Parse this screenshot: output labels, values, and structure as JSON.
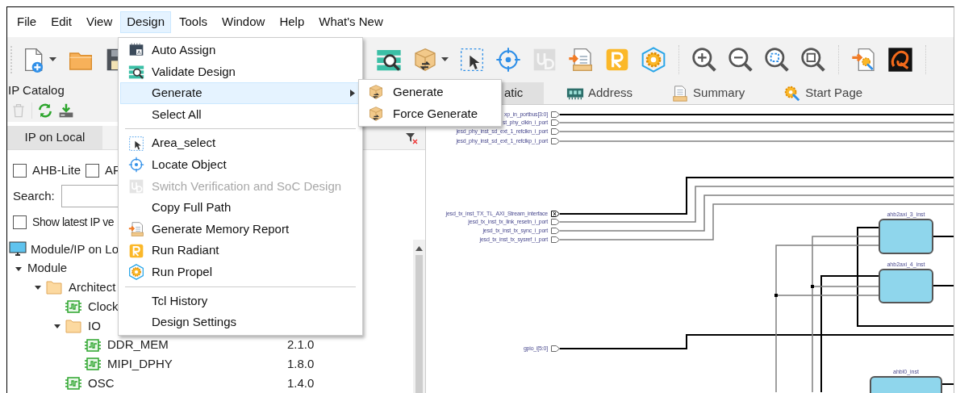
{
  "menu_bar": [
    {
      "label": "File",
      "selected": false
    },
    {
      "label": "Edit",
      "selected": false
    },
    {
      "label": "View",
      "selected": false
    },
    {
      "label": "Design",
      "selected": true
    },
    {
      "label": "Tools",
      "selected": false
    },
    {
      "label": "Window",
      "selected": false
    },
    {
      "label": "Help",
      "selected": false
    },
    {
      "label": "What's New",
      "selected": false
    }
  ],
  "toolbar": {
    "left": [
      {
        "kind": "new",
        "dropdown": true,
        "disabled": false
      },
      {
        "kind": "open",
        "dropdown": false,
        "disabled": false
      },
      {
        "kind": "save",
        "dropdown": false,
        "disabled": false
      }
    ],
    "right": [
      {
        "kind": "validate",
        "dropdown": false,
        "disabled": false
      },
      {
        "kind": "generate",
        "dropdown": true,
        "disabled": false
      },
      {
        "kind": "area_select",
        "dropdown": false,
        "disabled": false
      },
      {
        "kind": "locate",
        "dropdown": false,
        "disabled": false
      },
      {
        "kind": "switch",
        "dropdown": false,
        "disabled": true
      },
      {
        "kind": "memory_report",
        "dropdown": false,
        "disabled": false
      },
      {
        "kind": "radiant",
        "dropdown": false,
        "disabled": false
      },
      {
        "kind": "propel",
        "dropdown": false,
        "disabled": false
      },
      {
        "kind": "separator"
      },
      {
        "kind": "zoom_in",
        "dropdown": false,
        "disabled": false
      },
      {
        "kind": "zoom_out",
        "dropdown": false,
        "disabled": false
      },
      {
        "kind": "zoom_fit",
        "dropdown": false,
        "disabled": false
      },
      {
        "kind": "zoom_area",
        "dropdown": false,
        "disabled": false
      },
      {
        "kind": "separator"
      },
      {
        "kind": "generate_doc",
        "dropdown": false,
        "disabled": false
      },
      {
        "kind": "q_logo",
        "dropdown": false,
        "disabled": false
      },
      {
        "kind": "separator"
      }
    ]
  },
  "design_menu": {
    "items": [
      {
        "kind": "auto_assign",
        "label": "Auto Assign",
        "selected": false,
        "disabled": false,
        "submenu": false
      },
      {
        "kind": "validate",
        "label": "Validate Design",
        "selected": false,
        "disabled": false,
        "submenu": false
      },
      {
        "kind": "plain",
        "label": "Generate",
        "selected": true,
        "disabled": false,
        "submenu": true
      },
      {
        "kind": "plain",
        "label": "Select All",
        "selected": false,
        "disabled": false,
        "submenu": false
      },
      {
        "kind": "separator"
      },
      {
        "kind": "area_select",
        "label": "Area_select",
        "selected": false,
        "disabled": false,
        "submenu": false
      },
      {
        "kind": "locate",
        "label": "Locate Object",
        "selected": false,
        "disabled": false,
        "submenu": false
      },
      {
        "kind": "switch",
        "label": "Switch Verification and SoC Design",
        "selected": false,
        "disabled": true,
        "submenu": false
      },
      {
        "kind": "plain",
        "label": "Copy Full Path",
        "selected": false,
        "disabled": false,
        "submenu": false
      },
      {
        "kind": "memory_report",
        "label": "Generate Memory Report",
        "selected": false,
        "disabled": false,
        "submenu": false
      },
      {
        "kind": "radiant",
        "label": "Run Radiant",
        "selected": false,
        "disabled": false,
        "submenu": false
      },
      {
        "kind": "propel",
        "label": "Run Propel",
        "selected": false,
        "disabled": false,
        "submenu": false
      },
      {
        "kind": "separator"
      },
      {
        "kind": "plain",
        "label": "Tcl History",
        "selected": false,
        "disabled": false,
        "submenu": false
      },
      {
        "kind": "plain",
        "label": "Design Settings",
        "selected": false,
        "disabled": false,
        "submenu": false
      }
    ]
  },
  "generate_submenu": {
    "items": [
      {
        "kind": "generate",
        "label": "Generate",
        "selected": false
      },
      {
        "kind": "generate",
        "label": "Force Generate",
        "selected": false
      }
    ]
  },
  "ip_catalog": {
    "title": "IP Catalog",
    "toolbar": [
      {
        "kind": "delete",
        "disabled": true
      },
      {
        "kind": "refresh",
        "disabled": false
      },
      {
        "kind": "install",
        "disabled": false
      }
    ],
    "tabs": [
      {
        "label": "IP on Local",
        "selected": true
      }
    ],
    "filters": [
      {
        "label": "AHB-Lite",
        "checked": false
      },
      {
        "label": "AP",
        "checked": false
      }
    ],
    "search": {
      "label": "Search:"
    },
    "show_latest": {
      "label": "Show latest IP ve",
      "checked": false
    },
    "tree": {
      "header": "Module/IP on Lo",
      "items": [
        {
          "label": "Module",
          "kind": "group",
          "expanded": true,
          "children": [
            {
              "label": "Architect",
              "kind": "folder",
              "expanded": true,
              "children": [
                {
                  "label": "Clock",
                  "kind": "ip"
                },
                {
                  "label": "IO",
                  "kind": "folder",
                  "expanded": true,
                  "children": [
                    {
                      "label": "DDR_MEM",
                      "kind": "ip",
                      "version": "2.1.0"
                    },
                    {
                      "label": "MIPI_DPHY",
                      "kind": "ip",
                      "version": "1.8.0"
                    }
                  ]
                },
                {
                  "label": "OSC",
                  "kind": "ip",
                  "version": "1.4.0"
                }
              ]
            }
          ]
        }
      ]
    }
  },
  "editor_tabs": [
    {
      "kind": "schematic",
      "label": "atic",
      "selected": true
    },
    {
      "kind": "address",
      "label": "Address",
      "selected": false
    },
    {
      "kind": "summary",
      "label": "Summary",
      "selected": false
    },
    {
      "kind": "start",
      "label": "Start Page",
      "selected": false
    }
  ],
  "schematic": {
    "ports": [
      {
        "label": "xp_in_portbus[3:0]",
        "kind": "bus"
      },
      {
        "label": "st_phy_clkin_i_port",
        "kind": "wire"
      },
      {
        "label": "jesd_phy_inst_sd_ext_1_refclkn_i_port",
        "kind": "wire"
      },
      {
        "label": "jesd_phy_inst_sd_ext_1_refclkp_i_port",
        "kind": "wire"
      },
      {
        "label": "jesd_tx_inst_TX_TL_AXI_Stream_interface",
        "kind": "interface"
      },
      {
        "label": "jesd_tx_inst_tx_link_resetn_i_port",
        "kind": "wire"
      },
      {
        "label": "jesd_tx_inst_tx_sync_i_port",
        "kind": "wire"
      },
      {
        "label": "jesd_tx_inst_tx_sysref_i_port",
        "kind": "wire"
      },
      {
        "label": "gpio_i[5:0]",
        "kind": "bus"
      }
    ],
    "blocks": [
      {
        "label": "ahb2axi_3_inst"
      },
      {
        "label": "ahb2axi_4_inst"
      },
      {
        "label": "ahbl0_inst"
      }
    ]
  }
}
